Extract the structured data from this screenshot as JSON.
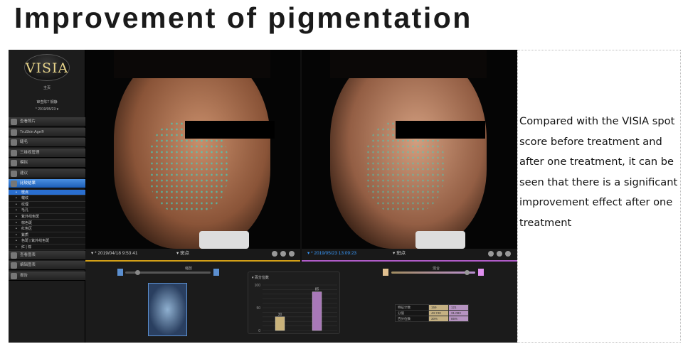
{
  "title": "Improvement of pigmentation",
  "description": "Compared with the VISIA spot score before treatment and after one treatment, it can be seen that there is a significant improvement effect after one treatment",
  "app": {
    "logo": "VISIA",
    "home": "主页",
    "patient": "审查陈T 钢静",
    "session": "* 2019/05/23 ▾",
    "nav": [
      "查看照片",
      "TruSkin Age®",
      "睫毛",
      "三维视管理",
      "模拟",
      "建议",
      "比较结果"
    ],
    "sub": [
      "斑点",
      "皱纹",
      "纹理",
      "毛孔",
      "紫外线色斑",
      "棕色斑",
      "红色区",
      "紫质",
      "色斑 | 紫外线色斑",
      "红 | 棕"
    ],
    "nav2": [
      "查看图表",
      "编辑图表",
      "报告"
    ],
    "left": {
      "date": "▾ * 2019/04/18 9:53:41",
      "mode": "▾ 斑点",
      "accent": "#d4a017"
    },
    "right": {
      "date": "▾ * 2019/05/23 13:09:23",
      "mode": "▾ 斑点",
      "accent": "#b05cc8"
    },
    "zoom_label": "缩放",
    "blend_label": "混合",
    "zoom_value": 0.12,
    "blend_value": 0.93
  },
  "chart_data": {
    "type": "bar",
    "title": "▾ 百分位数",
    "categories": [
      "2019/04/18",
      "2019/05/23"
    ],
    "values": [
      30,
      85
    ],
    "ylim": [
      0,
      100
    ],
    "yticks": [
      "0",
      "50",
      "100"
    ],
    "colors": [
      "#c9b27a",
      "#a878b8"
    ]
  },
  "table": {
    "rows": [
      [
        "特征计数",
        "159",
        "121"
      ],
      [
        "分值",
        "43.740",
        "31.083"
      ],
      [
        "百分位数",
        "30%",
        "85%"
      ]
    ]
  }
}
